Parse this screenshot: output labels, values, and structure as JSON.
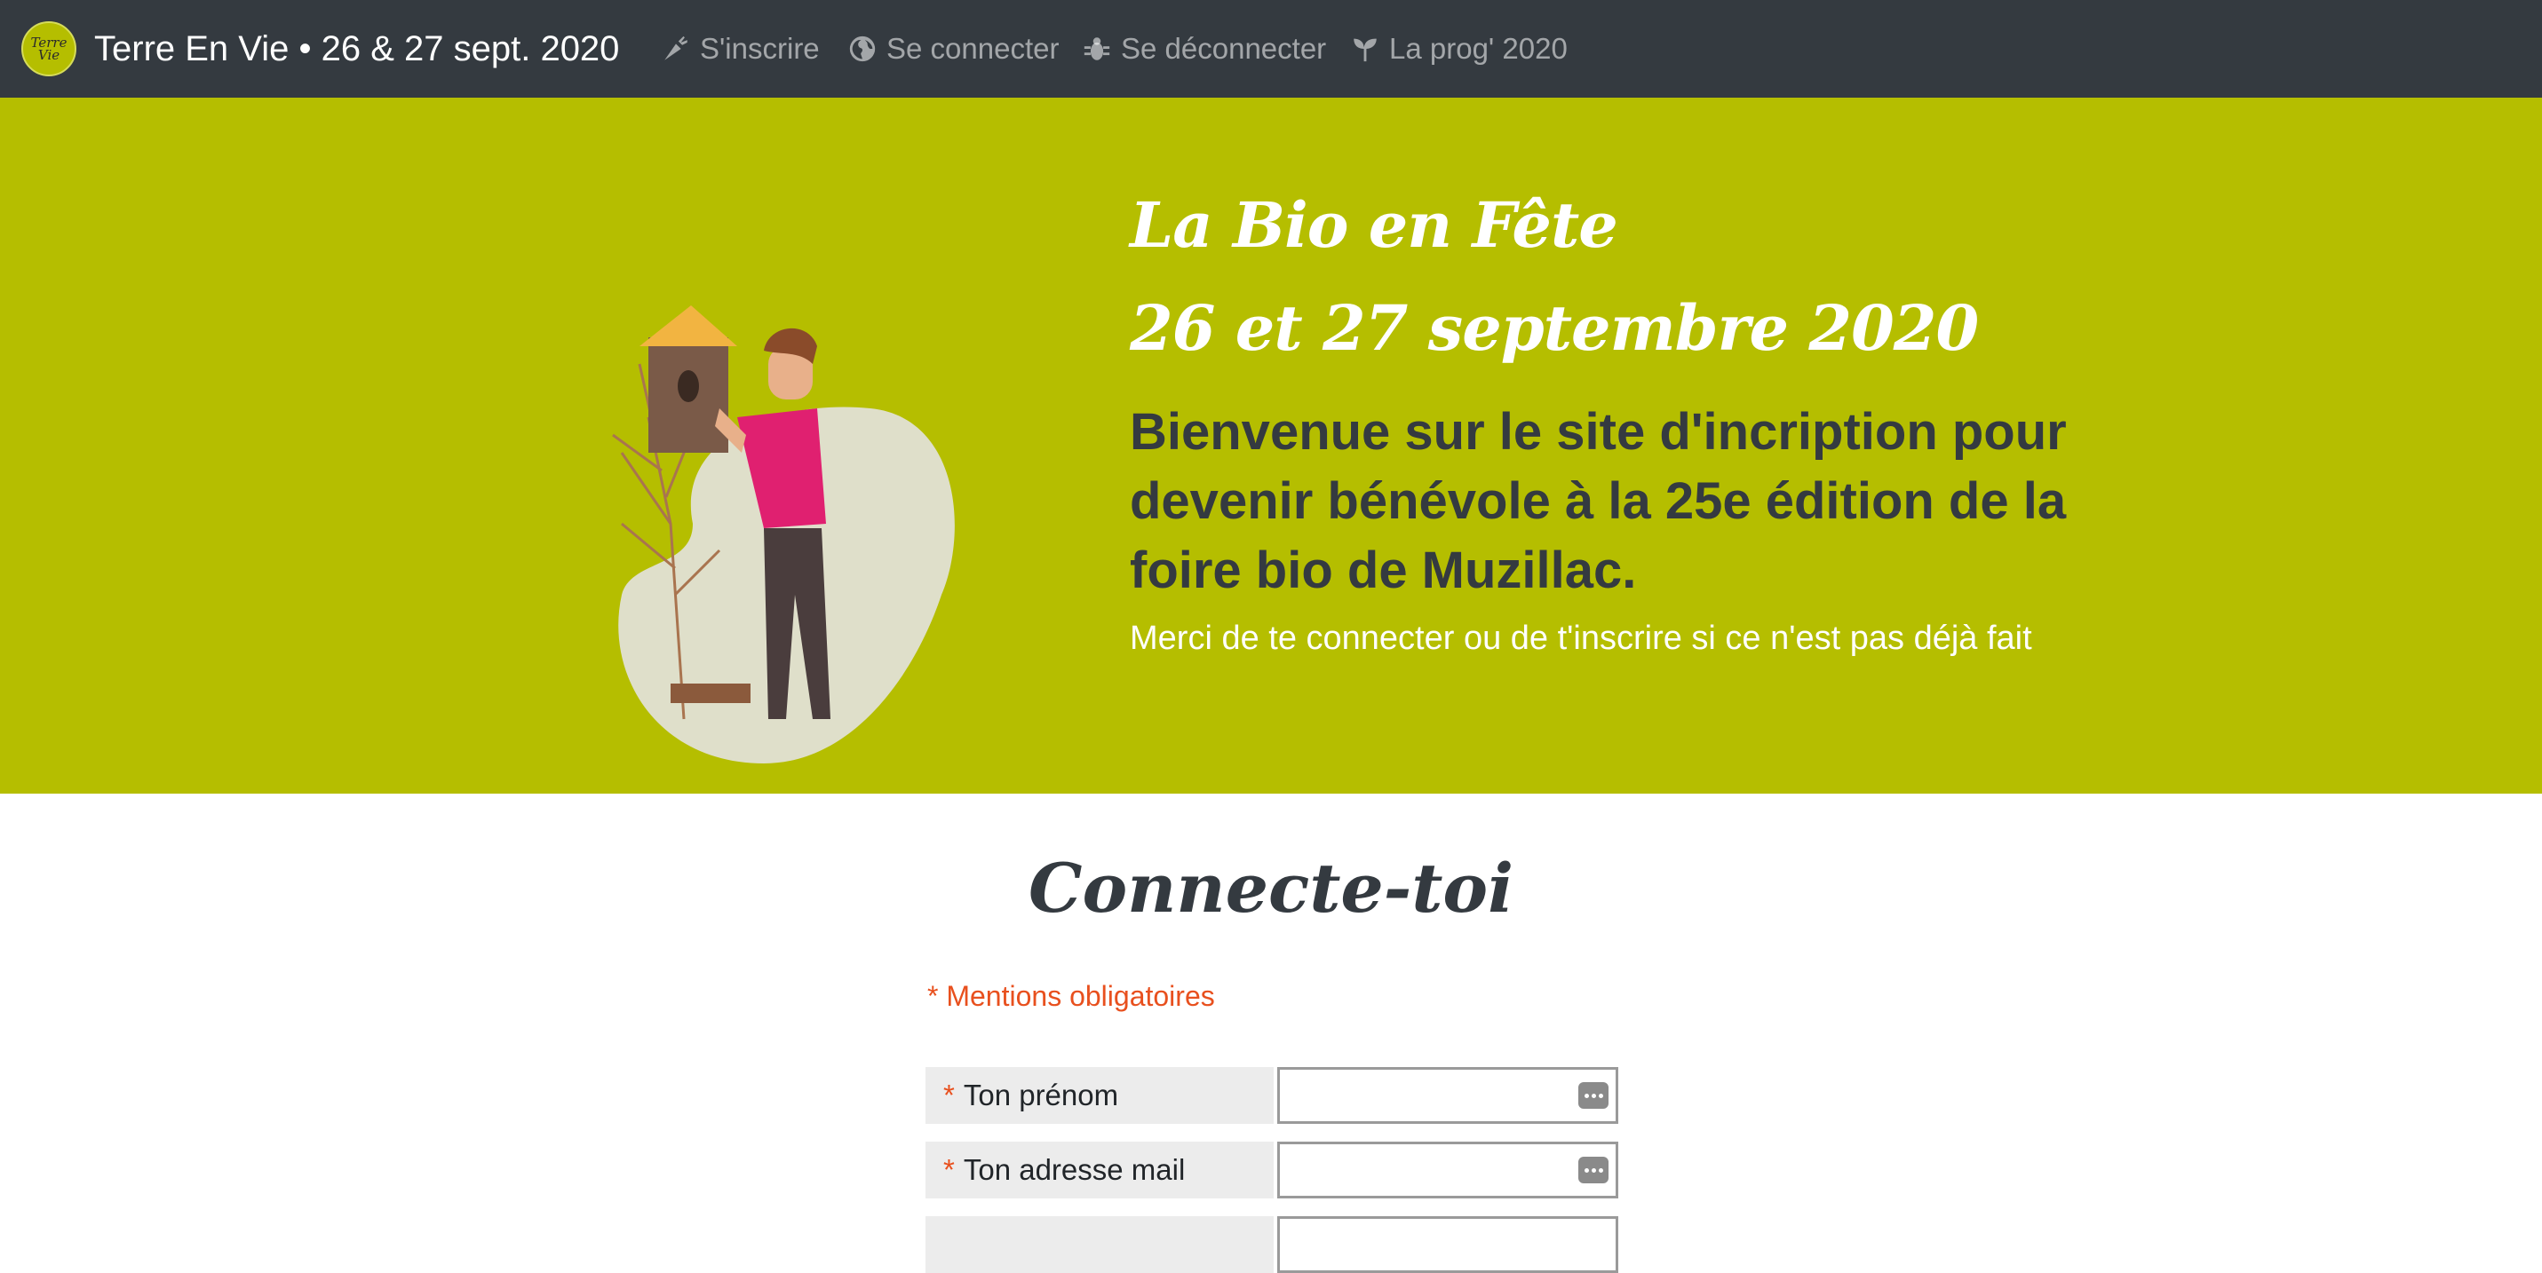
{
  "navbar": {
    "logo_text": "Terre Vie",
    "brand": "Terre En Vie • 26 & 27 sept. 2020",
    "items": [
      {
        "label": "S'inscrire",
        "icon": "carrot-icon"
      },
      {
        "label": "Se connecter",
        "icon": "globe-icon"
      },
      {
        "label": "Se déconnecter",
        "icon": "bug-icon"
      },
      {
        "label": "La prog' 2020",
        "icon": "seedling-icon"
      }
    ]
  },
  "hero": {
    "title": "La Bio en Fête",
    "dates": "26 et 27 septembre 2020",
    "lead": "Bienvenue sur le site d'incription pour devenir bénévole à la 25e édition de la foire bio de Muzillac.",
    "sub": "Merci de te connecter ou de t'inscrire si ce n'est pas déjà fait"
  },
  "form": {
    "title": "Connecte-toi",
    "required_note": "* Mentions obligatoires",
    "fields": [
      {
        "label": "Ton prénom",
        "value": ""
      },
      {
        "label": "Ton adresse mail",
        "value": ""
      },
      {
        "label": "",
        "value": ""
      }
    ]
  },
  "colors": {
    "navbar": "#343a40",
    "hero": "#b5be00",
    "required": "#e8501e"
  }
}
